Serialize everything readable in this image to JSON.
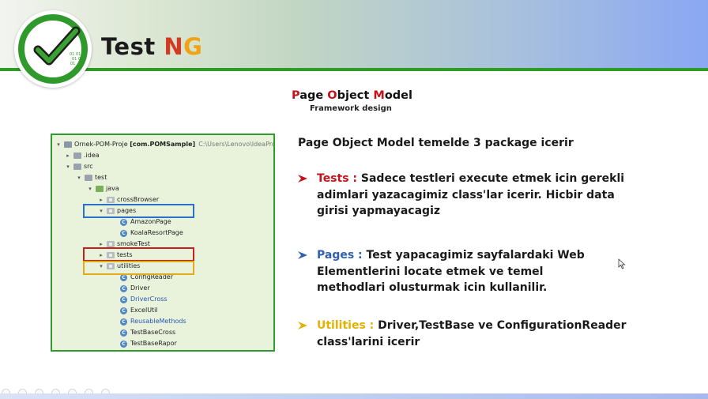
{
  "header": {
    "brand_test": "Test",
    "brand_n": "N",
    "brand_g": "G",
    "logo_text_top": "01 01",
    "logo_text_mid": "01 01",
    "logo_text_bot": "01"
  },
  "slide": {
    "title_p": "P",
    "title_age": "age ",
    "title_o": "O",
    "title_bject": "bject ",
    "title_m": "M",
    "title_odel": "odel",
    "subtitle": "Framework design"
  },
  "tree": {
    "project_name": "Ornek-POM-Proje",
    "project_module": "[com.POMSample]",
    "project_path": "C:\\Users\\Lenovo\\IdeaProject",
    "items": [
      {
        "label": ".idea"
      },
      {
        "label": "src"
      },
      {
        "label": "test"
      },
      {
        "label": "java"
      },
      {
        "label": "crossBrowser"
      },
      {
        "label": "pages"
      },
      {
        "label": "AmazonPage"
      },
      {
        "label": "KoalaResortPage"
      },
      {
        "label": "smokeTest"
      },
      {
        "label": "tests"
      },
      {
        "label": "utilities"
      },
      {
        "label": "ConfigReader"
      },
      {
        "label": "Driver"
      },
      {
        "label": "DriverCross"
      },
      {
        "label": "ExcelUtil"
      },
      {
        "label": "ReusableMethods"
      },
      {
        "label": "TestBaseCross"
      },
      {
        "label": "TestBaseRapor"
      }
    ],
    "class_icon_letter": "C"
  },
  "content": {
    "intro": "Page Object Model temelde 3 package icerir",
    "tests_label": "Tests :",
    "tests_text": "Sadece testleri execute etmek icin gerekli adimlari yazacagimiz class'lar icerir. Hicbir data girisi yapmayacagiz",
    "pages_label": "Pages :",
    "pages_text": "Test yapacagimiz sayfalardaki Web Elementlerini locate etmek ve temel methodlari olusturmak icin kullanilir.",
    "utilities_label": "Utilities :",
    "utilities_text": "Driver,TestBase ve ConfigurationReader class'larini icerir"
  },
  "colors": {
    "green": "#2e9b27",
    "red": "#c4131a",
    "blue": "#2f5fb2",
    "yellow": "#e5b100",
    "box_blue": "#2a6fc9",
    "box_red": "#c8201c",
    "box_yellow": "#e6a91a"
  }
}
